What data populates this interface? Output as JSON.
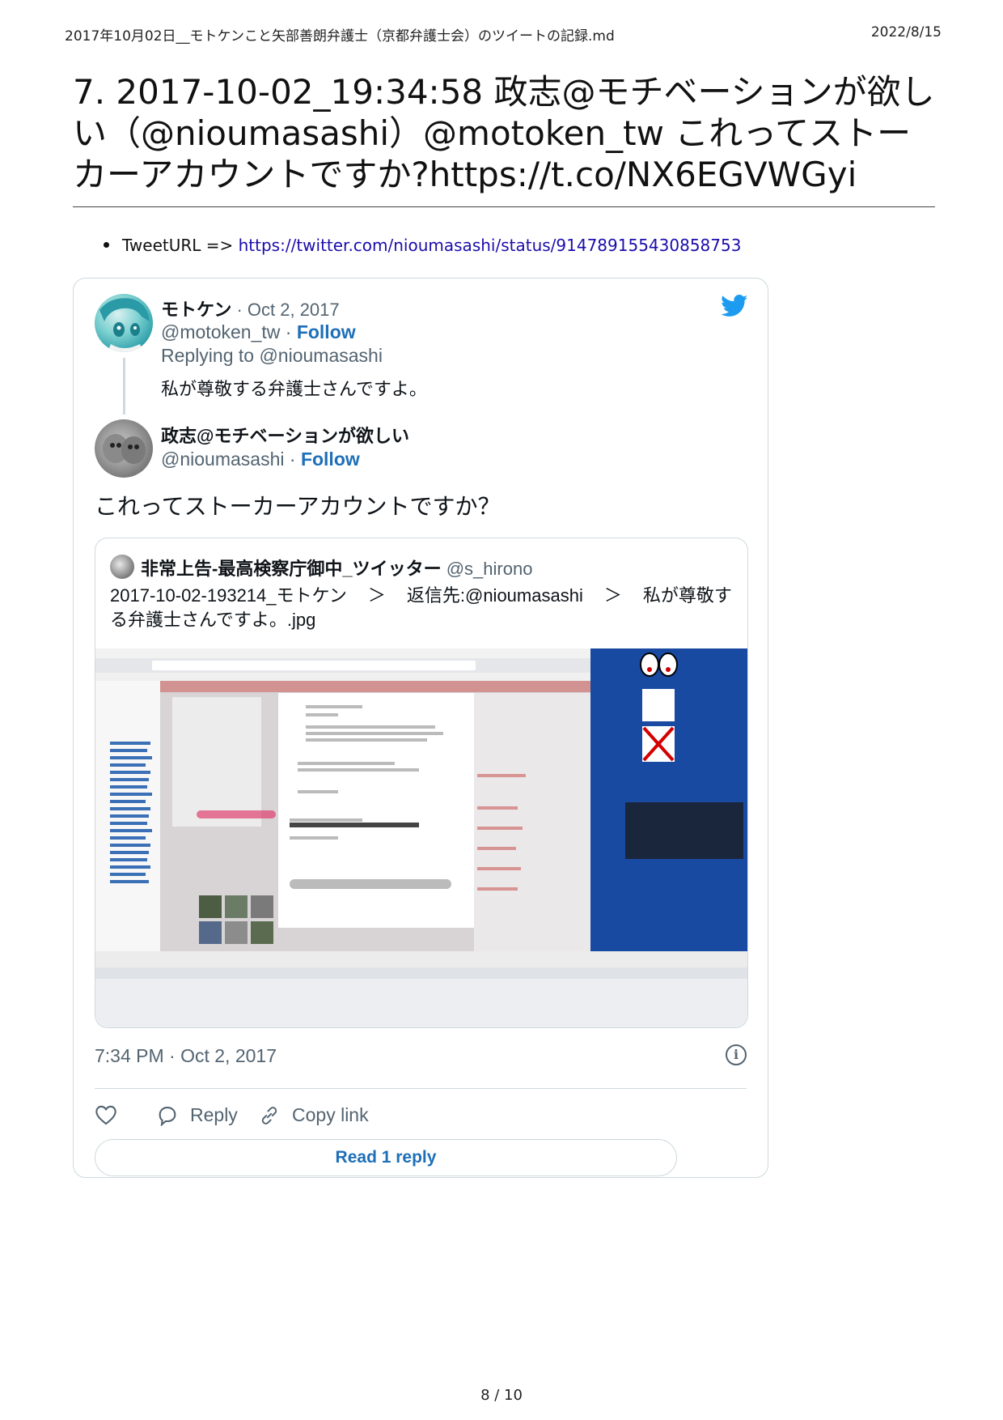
{
  "header": {
    "left": "2017年10月02日__モトケンこと矢部善朗弁護士（京都弁護士会）のツイートの記録.md",
    "right": "2022/8/15"
  },
  "title": "7. 2017-10-02_19:34:58 政志@モチベーションが欲しい（@nioumasashi）@motoken_tw これってストーカーアカウントですか?https://t.co/NX6EGVWGyi",
  "tweet_url": {
    "label": "TweetURL => ",
    "url": "https://twitter.com/nioumasashi/status/914789155430858753"
  },
  "card": {
    "reply": {
      "name": "モトケン",
      "date": " · Oct 2, 2017",
      "handle": "@motoken_tw",
      "follow": "Follow",
      "replying_to": "Replying to @nioumasashi",
      "text": "私が尊敬する弁護士さんですよ。"
    },
    "main": {
      "name": "政志@モチベーションが欲しい",
      "handle": "@nioumasashi",
      "follow": "Follow",
      "text": "これってストーカーアカウントですか？"
    },
    "quote": {
      "name": "非常上告-最高検察庁御中_ツイッター",
      "handle": "@s_hirono",
      "text_part1": "2017-10-02-193214_モトケン",
      "gt": "＞",
      "text_part2": "返信先:@nioumasashi",
      "text_part3": "私が尊敬する弁護士さんですよ。.jpg"
    },
    "timestamp": "7:34 PM · Oct 2, 2017",
    "actions": {
      "reply": "Reply",
      "copy_link": "Copy link"
    },
    "read_reply": "Read 1 reply"
  },
  "page_number": "8 / 10"
}
